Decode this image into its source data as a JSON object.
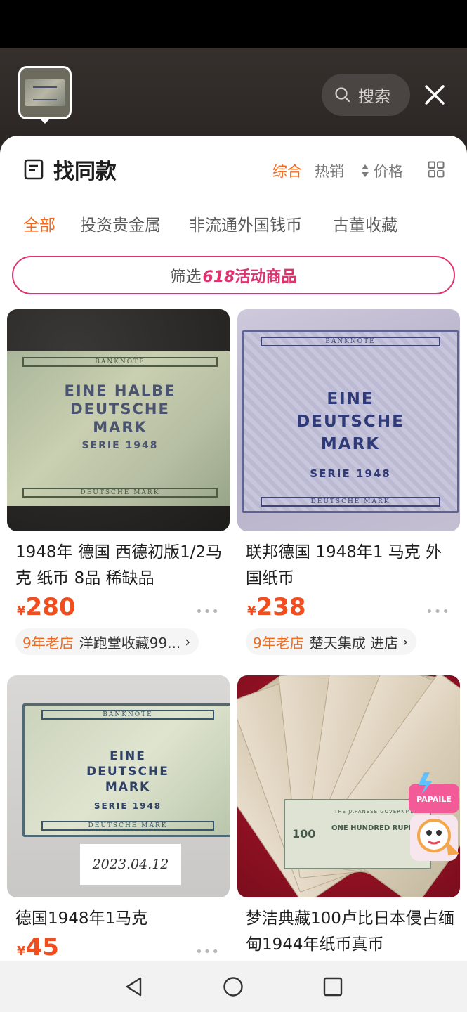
{
  "search_header": {
    "search_label": "搜索",
    "close_icon": "close-icon",
    "search_icon": "search-icon"
  },
  "panel": {
    "title": "找同款",
    "sort": {
      "comprehensive": "综合",
      "hot": "热销",
      "price": "价格"
    },
    "categories": [
      "全部",
      "投资贵金属",
      "非流通外国钱币",
      "古董收藏"
    ],
    "promo": {
      "prefix": "筛选",
      "number": "618",
      "suffix": "活动商品"
    }
  },
  "products": [
    {
      "title": "1948年 德国 西德初版1/2马克 纸币 8品 稀缺品",
      "currency": "¥",
      "price": "280",
      "more": "•••",
      "shop_age": "9年老店",
      "shop_name": "洋跑堂收藏99...",
      "chevron": "›",
      "image": {
        "top": "BANKNOTE",
        "line1": "EINE HALBE",
        "line2": "DEUTSCHE",
        "line3": "MARK",
        "serie": "SERIE 1948",
        "bottom": "DEUTSCHE MARK"
      }
    },
    {
      "title": "联邦德国 1948年1 马克 外国纸币",
      "currency": "¥",
      "price": "238",
      "more": "•••",
      "shop_age": "9年老店",
      "shop_name": "楚天集成 进店",
      "chevron": "›",
      "image": {
        "top": "BANKNOTE",
        "line1": "EINE",
        "line2": "DEUTSCHE",
        "line3": "MARK",
        "serie": "SERIE 1948",
        "bottom": "DEUTSCHE MARK"
      }
    },
    {
      "title": "德国1948年1马克",
      "currency": "¥",
      "price": "45",
      "more": "•••",
      "image": {
        "top": "BANKNOTE",
        "line1": "EINE",
        "line2": "DEUTSCHE",
        "line3": "MARK",
        "serie": "SERIE 1948",
        "bottom": "DEUTSCHE MARK",
        "date_tag": "2023.04.12"
      }
    },
    {
      "title": "梦洁典藏100卢比日本侵占缅甸1944年纸币真币",
      "image": {
        "issuer": "THE JAPANESE GOVERNMENT",
        "value_words": "ONE HUNDRED RUPEES",
        "value": "100",
        "badge_text": "PAPAILE"
      }
    }
  ],
  "nav": {
    "back_icon": "back-triangle-icon",
    "home_icon": "home-circle-icon",
    "recents_icon": "recents-square-icon"
  },
  "colors": {
    "accent": "#f06a1f",
    "price": "#f24d1e",
    "promo": "#e1316f"
  }
}
